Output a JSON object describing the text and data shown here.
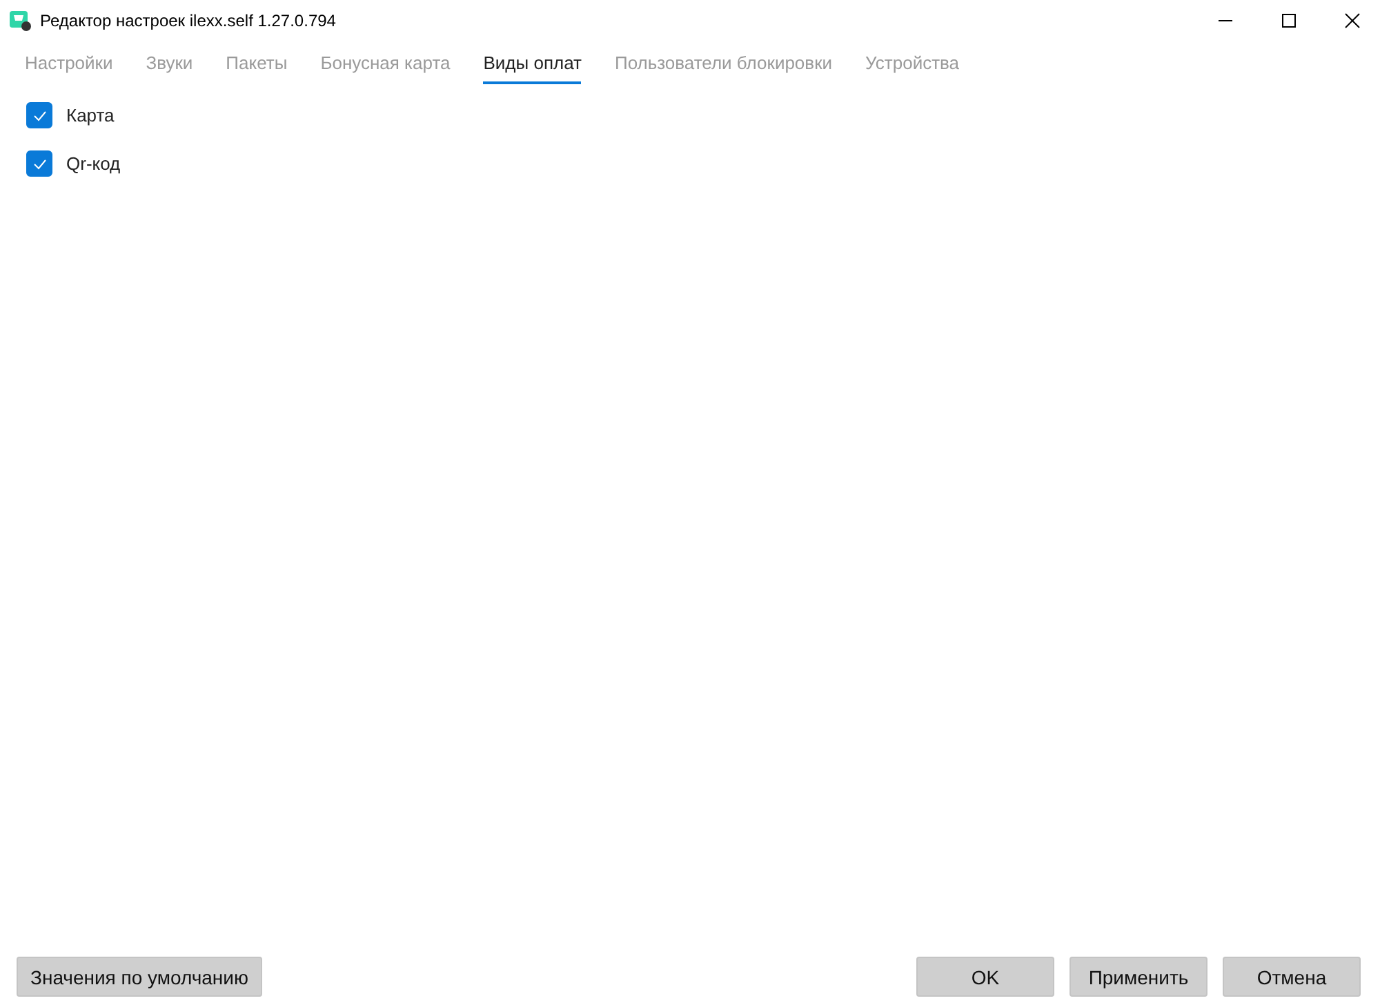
{
  "window": {
    "title": "Редактор настроек ilexx.self 1.27.0.794"
  },
  "tabs": [
    {
      "label": "Настройки",
      "selected": false
    },
    {
      "label": "Звуки",
      "selected": false
    },
    {
      "label": "Пакеты",
      "selected": false
    },
    {
      "label": "Бонусная карта",
      "selected": false
    },
    {
      "label": "Виды оплат",
      "selected": true
    },
    {
      "label": "Пользователи блокировки",
      "selected": false
    },
    {
      "label": "Устройства",
      "selected": false
    }
  ],
  "options": [
    {
      "label": "Карта",
      "checked": true
    },
    {
      "label": "Qr-код",
      "checked": true
    }
  ],
  "buttons": {
    "left": [
      "Значения по умолчанию"
    ],
    "right": [
      "OK",
      "Применить",
      "Отмена"
    ]
  }
}
